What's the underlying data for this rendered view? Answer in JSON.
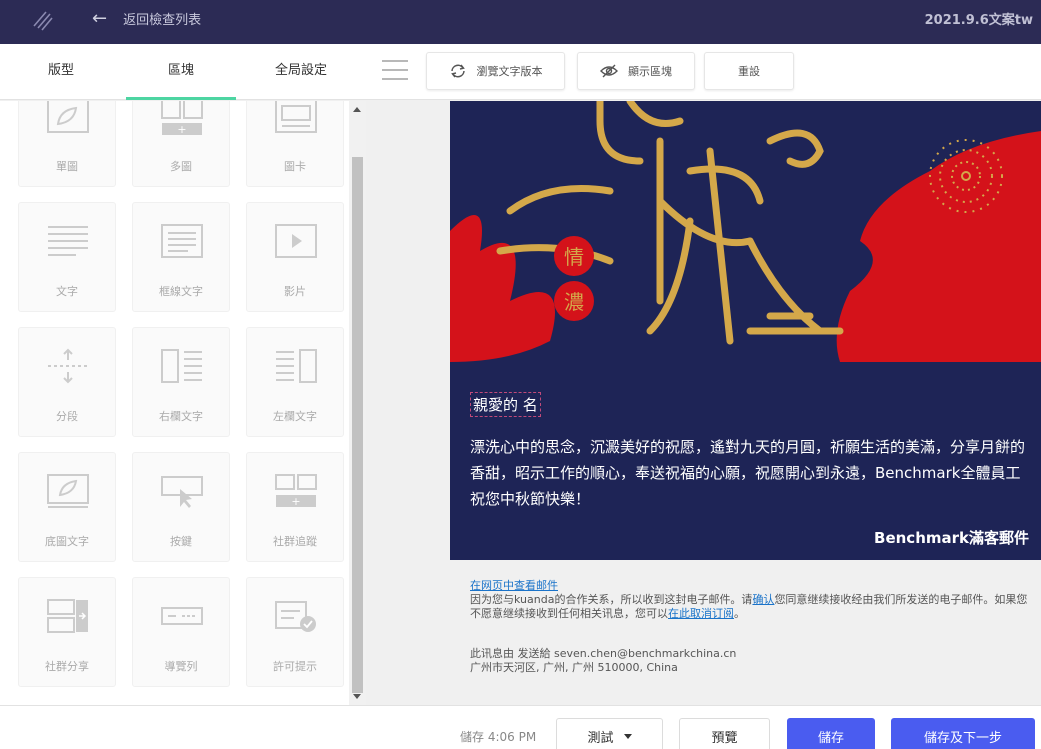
{
  "header": {
    "back_label": "返回檢查列表",
    "campaign_name": "2021.9.6文案tw"
  },
  "tabs": [
    {
      "label": "版型"
    },
    {
      "label": "區塊"
    },
    {
      "label": "全局設定"
    }
  ],
  "toolbar": {
    "text_version": "瀏覽文字版本",
    "show_blocks": "顯示區塊",
    "reset": "重設"
  },
  "blocks": [
    {
      "label": "單圖",
      "icon": "single-image-icon"
    },
    {
      "label": "多圖",
      "icon": "multi-image-icon"
    },
    {
      "label": "圖卡",
      "icon": "image-card-icon"
    },
    {
      "label": "文字",
      "icon": "text-icon"
    },
    {
      "label": "框線文字",
      "icon": "boxed-text-icon"
    },
    {
      "label": "影片",
      "icon": "video-icon"
    },
    {
      "label": "分段",
      "icon": "divider-icon"
    },
    {
      "label": "右欄文字",
      "icon": "right-column-text-icon"
    },
    {
      "label": "左欄文字",
      "icon": "left-column-text-icon"
    },
    {
      "label": "底圖文字",
      "icon": "background-image-text-icon"
    },
    {
      "label": "按鍵",
      "icon": "button-icon"
    },
    {
      "label": "社群追蹤",
      "icon": "social-follow-icon"
    },
    {
      "label": "社群分享",
      "icon": "social-share-icon"
    },
    {
      "label": "導覽列",
      "icon": "navbar-icon"
    },
    {
      "label": "許可提示",
      "icon": "permission-reminder-icon"
    }
  ],
  "email": {
    "hero_chars": [
      "情",
      "濃"
    ],
    "greeting": "親愛的 名",
    "body": "漂洗心中的思念，沉澱美好的祝愿，遙對九天的月圓，祈願生活的美滿，分享月餅的香甜，昭示工作的順心，奉送祝福的心願，祝愿開心到永遠，Benchmark全體員工祝您中秋節快樂！",
    "signoff": "Benchmark滿客郵件",
    "footer": {
      "view_web": "在网页中查看邮件",
      "notice_1": "因为您与kuanda的合作关系，所以收到这封电子邮件。请",
      "confirm": "确认",
      "notice_2": "您同意继续接收经由我们所发送的电子邮件。如果您不愿意继续接收到任何相关讯息，您可以",
      "unsubscribe": "在此取消订阅",
      "notice_3": "。",
      "sender": "此讯息由 发送給 seven.chen@benchmarkchina.cn",
      "address": "广州市天河区, 广州, 广州 510000, China"
    }
  },
  "bottom": {
    "saved": "儲存 4:06 PM",
    "test": "測試",
    "preview": "預覽",
    "save": "儲存",
    "save_next": "儲存及下一步"
  },
  "colors": {
    "header_bg": "#2c2b55",
    "active_tab": "#4dd5a2",
    "primary": "#4a5cf0",
    "email_bg": "#1e2456",
    "hero_red": "#d4121a",
    "hero_gold": "#d4a84a"
  }
}
